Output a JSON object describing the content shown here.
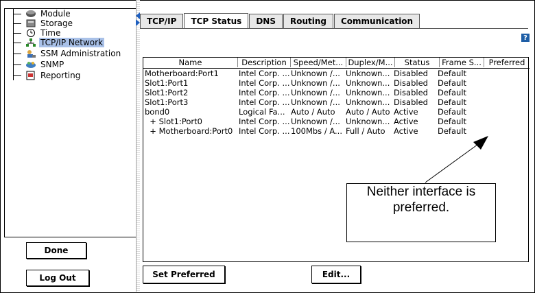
{
  "sidebar": {
    "items": [
      {
        "label": "Module",
        "icon": "module-icon",
        "selected": false
      },
      {
        "label": "Storage",
        "icon": "storage-icon",
        "selected": false
      },
      {
        "label": "Time",
        "icon": "clock-icon",
        "selected": false
      },
      {
        "label": "TCP/IP Network",
        "icon": "network-icon",
        "selected": true
      },
      {
        "label": "SSM Administration",
        "icon": "admin-icon",
        "selected": false
      },
      {
        "label": "SNMP",
        "icon": "snmp-icon",
        "selected": false
      },
      {
        "label": "Reporting",
        "icon": "report-icon",
        "selected": false
      }
    ],
    "done_label": "Done",
    "logout_label": "Log Out"
  },
  "tabs": [
    {
      "label": "TCP/IP",
      "active": false
    },
    {
      "label": "TCP Status",
      "active": true
    },
    {
      "label": "DNS",
      "active": false
    },
    {
      "label": "Routing",
      "active": false
    },
    {
      "label": "Communication",
      "active": false
    }
  ],
  "help_label": "?",
  "table": {
    "columns": [
      "Name",
      "Description",
      "Speed/Met...",
      "Duplex/M...",
      "Status",
      "Frame S...",
      "Preferred"
    ],
    "rows": [
      [
        "Motherboard:Port1",
        "Intel Corp. ...",
        "Unknown /...",
        "Unknown...",
        "Disabled",
        "Default",
        ""
      ],
      [
        "Slot1:Port1",
        "Intel Corp. ...",
        "Unknown /...",
        "Unknown...",
        "Disabled",
        "Default",
        ""
      ],
      [
        "Slot1:Port2",
        "Intel Corp. ...",
        "Unknown /...",
        "Unknown...",
        "Disabled",
        "Default",
        ""
      ],
      [
        "Slot1:Port3",
        "Intel Corp. ...",
        "Unknown /...",
        "Unknown...",
        "Disabled",
        "Default",
        ""
      ],
      [
        "bond0",
        "Logical Fa...",
        "Auto / Auto",
        "Auto / Auto",
        "Active",
        "Default",
        ""
      ],
      [
        "  + Slot1:Port0",
        "Intel Corp. ...",
        "Unknown /...",
        "Unknown...",
        "Active",
        "Default",
        ""
      ],
      [
        "  + Motherboard:Port0",
        "Intel Corp. ...",
        "100Mbs / A...",
        "Full / Auto",
        "Active",
        "Default",
        ""
      ]
    ]
  },
  "buttons": {
    "set_preferred": "Set Preferred",
    "edit": "Edit..."
  },
  "callout": {
    "line1": "Neither interface is",
    "line2": "preferred."
  },
  "colors": {
    "selection": "#a9c1e8",
    "help_bg": "#1e5ea6",
    "arrow": "#1f5fbf"
  }
}
